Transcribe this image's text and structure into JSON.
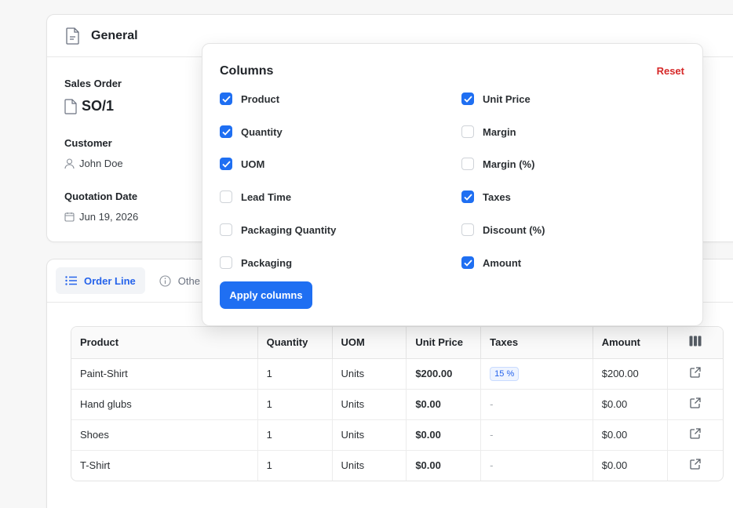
{
  "general": {
    "title": "General",
    "sales_order_label": "Sales Order",
    "sales_order_value": "SO/1",
    "customer_label": "Customer",
    "customer_value": "John Doe",
    "quotation_date_label": "Quotation Date",
    "quotation_date_value": "Jun 19, 2026"
  },
  "tabs": [
    {
      "label": "Order Line",
      "active": true,
      "icon": "list-icon"
    },
    {
      "label": "Othe",
      "active": false,
      "icon": "info-icon"
    }
  ],
  "table": {
    "columns": [
      "Product",
      "Quantity",
      "UOM",
      "Unit Price",
      "Taxes",
      "Amount"
    ],
    "rows": [
      {
        "product": "Paint-Shirt",
        "quantity": "1",
        "uom": "Units",
        "unit_price": "$200.00",
        "taxes": "15 %",
        "amount": "$200.00"
      },
      {
        "product": "Hand glubs",
        "quantity": "1",
        "uom": "Units",
        "unit_price": "$0.00",
        "taxes": "-",
        "amount": "$0.00"
      },
      {
        "product": "Shoes",
        "quantity": "1",
        "uom": "Units",
        "unit_price": "$0.00",
        "taxes": "-",
        "amount": "$0.00"
      },
      {
        "product": "T-Shirt",
        "quantity": "1",
        "uom": "Units",
        "unit_price": "$0.00",
        "taxes": "-",
        "amount": "$0.00"
      }
    ]
  },
  "columns_popover": {
    "title": "Columns",
    "reset_label": "Reset",
    "apply_label": "Apply columns",
    "left": [
      {
        "label": "Product",
        "checked": true
      },
      {
        "label": "Quantity",
        "checked": true
      },
      {
        "label": "UOM",
        "checked": true
      },
      {
        "label": "Lead Time",
        "checked": false
      },
      {
        "label": "Packaging Quantity",
        "checked": false
      },
      {
        "label": "Packaging",
        "checked": false
      }
    ],
    "right": [
      {
        "label": "Unit Price",
        "checked": true
      },
      {
        "label": "Margin",
        "checked": false
      },
      {
        "label": "Margin (%)",
        "checked": false
      },
      {
        "label": "Taxes",
        "checked": true
      },
      {
        "label": "Discount (%)",
        "checked": false
      },
      {
        "label": "Amount",
        "checked": true
      }
    ]
  },
  "colors": {
    "accent": "#1f6ff2",
    "reset": "#d62828",
    "tab_active": "#2563eb"
  }
}
